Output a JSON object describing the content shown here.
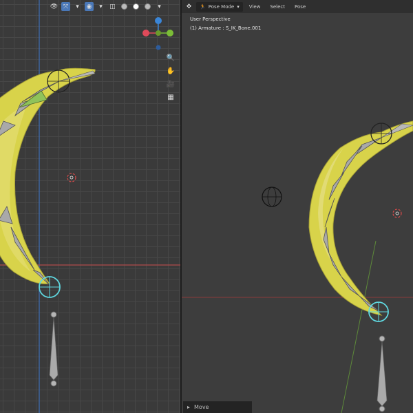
{
  "left_header": {
    "icons": [
      "eye-dropdown-icon",
      "transform-orientation-icon",
      "snap-icon",
      "proportional-icon",
      "overlay-toggle-icon",
      "wireframe-shading-icon",
      "solid-shading-icon",
      "material-shading-icon",
      "rendered-shading-icon",
      "view-options-icon"
    ]
  },
  "right_header": {
    "mode": "Pose Mode",
    "menus": [
      "View",
      "Select",
      "Pose"
    ]
  },
  "viewport_overlay": {
    "line1": "User Perspective",
    "line2": "(1) Armature : S_IK_Bone.001"
  },
  "gizmo": {
    "axes": [
      "x",
      "y",
      "z"
    ],
    "colors": {
      "x": "#e04a5a",
      "y": "#7bbd37",
      "z": "#3a86d8"
    }
  },
  "nav_tools": [
    "zoom-icon",
    "pan-hand-icon",
    "camera-icon",
    "grid-icon"
  ],
  "operator_panel": {
    "label": "Move"
  },
  "colors": {
    "banana": "#d8d34a",
    "bone": "#a9a9a9",
    "active_bone": "#8fc35a",
    "ik_circle": "#5fd8e0",
    "x_axis": "#b14a4a",
    "z_axis": "#3f6fb8"
  }
}
